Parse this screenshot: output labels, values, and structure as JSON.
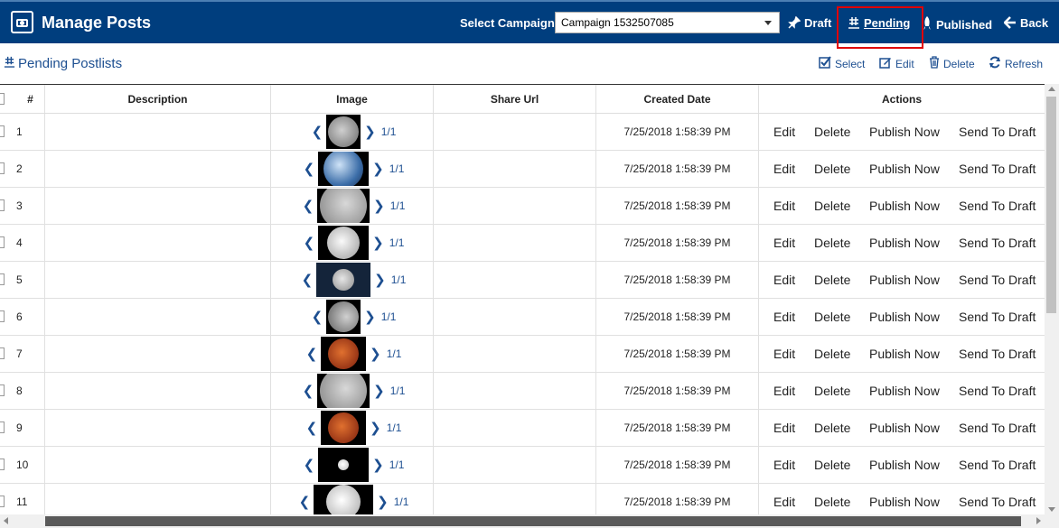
{
  "header": {
    "title": "Manage Posts",
    "campaign_label": "Select Campaign",
    "campaign_value": "Campaign 1532507085",
    "nav": {
      "draft": "Draft",
      "pending": "Pending",
      "published": "Published",
      "back": "Back"
    }
  },
  "subheader": {
    "title": "Pending Postlists",
    "tools": {
      "select": "Select",
      "edit": "Edit",
      "delete": "Delete",
      "refresh": "Refresh"
    }
  },
  "table": {
    "columns": {
      "num": "#",
      "description": "Description",
      "image": "Image",
      "share_url": "Share Url",
      "created_date": "Created Date",
      "actions": "Actions"
    },
    "actions": {
      "edit": "Edit",
      "delete": "Delete",
      "publish": "Publish Now",
      "draft": "Send To Draft"
    },
    "rows": [
      {
        "num": "1",
        "description": "",
        "page": "1/1",
        "share_url": "",
        "date": "7/25/2018 1:58:39 PM",
        "moon": "gray"
      },
      {
        "num": "2",
        "description": "",
        "page": "1/1",
        "share_url": "",
        "date": "7/25/2018 1:58:39 PM",
        "moon": "earth"
      },
      {
        "num": "3",
        "description": "",
        "page": "1/1",
        "share_url": "",
        "date": "7/25/2018 1:58:39 PM",
        "moon": "gray-large"
      },
      {
        "num": "4",
        "description": "",
        "page": "1/1",
        "share_url": "",
        "date": "7/25/2018 1:58:39 PM",
        "moon": "white"
      },
      {
        "num": "5",
        "description": "",
        "page": "1/1",
        "share_url": "",
        "date": "7/25/2018 1:58:39 PM",
        "moon": "small-blue"
      },
      {
        "num": "6",
        "description": "",
        "page": "1/1",
        "share_url": "",
        "date": "7/25/2018 1:58:39 PM",
        "moon": "gibbous"
      },
      {
        "num": "7",
        "description": "",
        "page": "1/1",
        "share_url": "",
        "date": "7/25/2018 1:58:39 PM",
        "moon": "blood"
      },
      {
        "num": "8",
        "description": "",
        "page": "1/1",
        "share_url": "",
        "date": "7/25/2018 1:58:39 PM",
        "moon": "gray-large"
      },
      {
        "num": "9",
        "description": "",
        "page": "1/1",
        "share_url": "",
        "date": "7/25/2018 1:58:39 PM",
        "moon": "blood"
      },
      {
        "num": "10",
        "description": "",
        "page": "1/1",
        "share_url": "",
        "date": "7/25/2018 1:58:39 PM",
        "moon": "tiny"
      },
      {
        "num": "11",
        "description": "",
        "page": "1/1",
        "share_url": "",
        "date": "7/25/2018 1:58:39 PM",
        "moon": "white-large"
      }
    ]
  },
  "colors": {
    "header_bg": "#003e7e",
    "link": "#1d4f91",
    "highlight": "#e00000"
  }
}
